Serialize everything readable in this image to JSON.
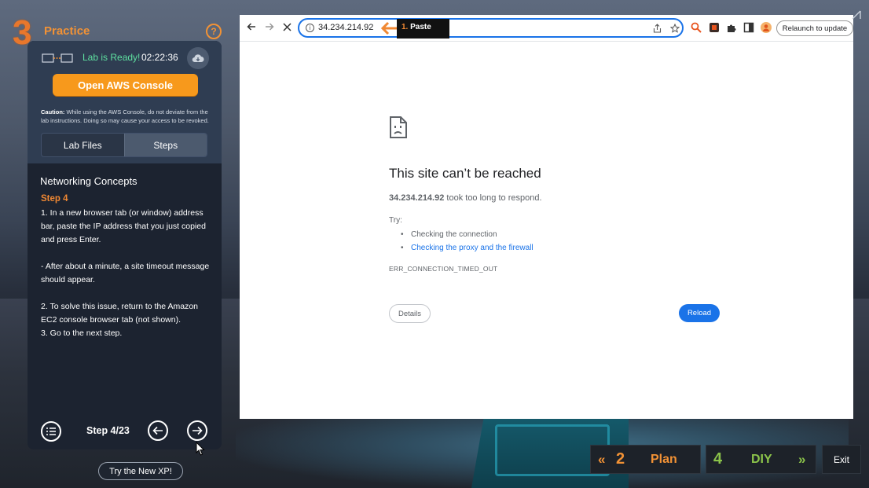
{
  "module": {
    "number": "3",
    "title": "Practice"
  },
  "help_label": "?",
  "lab": {
    "status": "Lab is Ready!",
    "timer": "02:22:36",
    "open_console_label": "Open AWS Console",
    "caution_label": "Caution:",
    "caution_text": " While using the AWS Console, do not deviate from the lab instructions. Doing so may cause your access to be revoked."
  },
  "tabs": [
    {
      "label": "Lab Files",
      "active": false
    },
    {
      "label": "Steps",
      "active": true
    }
  ],
  "content": {
    "section_title": "Networking Concepts",
    "step_heading": "Step 4",
    "lines": [
      "1. In a new browser tab (or window) address bar, paste the IP address that you just copied and press Enter.",
      "",
      "- After about a minute, a site timeout message should appear.",
      "",
      "2. To solve this issue, return to the Amazon EC2 console browser tab (not shown).",
      "3. Go to the next step."
    ]
  },
  "footer": {
    "step_counter": "Step 4/23"
  },
  "try_new_xp_label": "Try the New XP!",
  "browser": {
    "url": "34.234.214.92",
    "annotation_number": "1.",
    "annotation_label": " Paste",
    "relaunch_label": "Relaunch to update",
    "error": {
      "title": "This site can’t be reached",
      "host": "34.234.214.92",
      "desc_rest": " took too long to respond.",
      "try_label": "Try:",
      "suggestions": [
        "Checking the connection",
        "Checking the proxy and the firewall"
      ],
      "code": "ERR_CONNECTION_TIMED_OUT",
      "details_label": "Details",
      "reload_label": "Reload"
    }
  },
  "bottom_nav": {
    "plan_number": "2",
    "plan_label": "Plan",
    "diy_number": "4",
    "diy_label": "DIY",
    "exit_label": "Exit"
  },
  "colors": {
    "accent_orange": "#f29235",
    "aws_button": "#f7991c",
    "diy_green": "#8bc34a",
    "ready_green": "#5ee0a0",
    "link_blue": "#1a73e8"
  }
}
